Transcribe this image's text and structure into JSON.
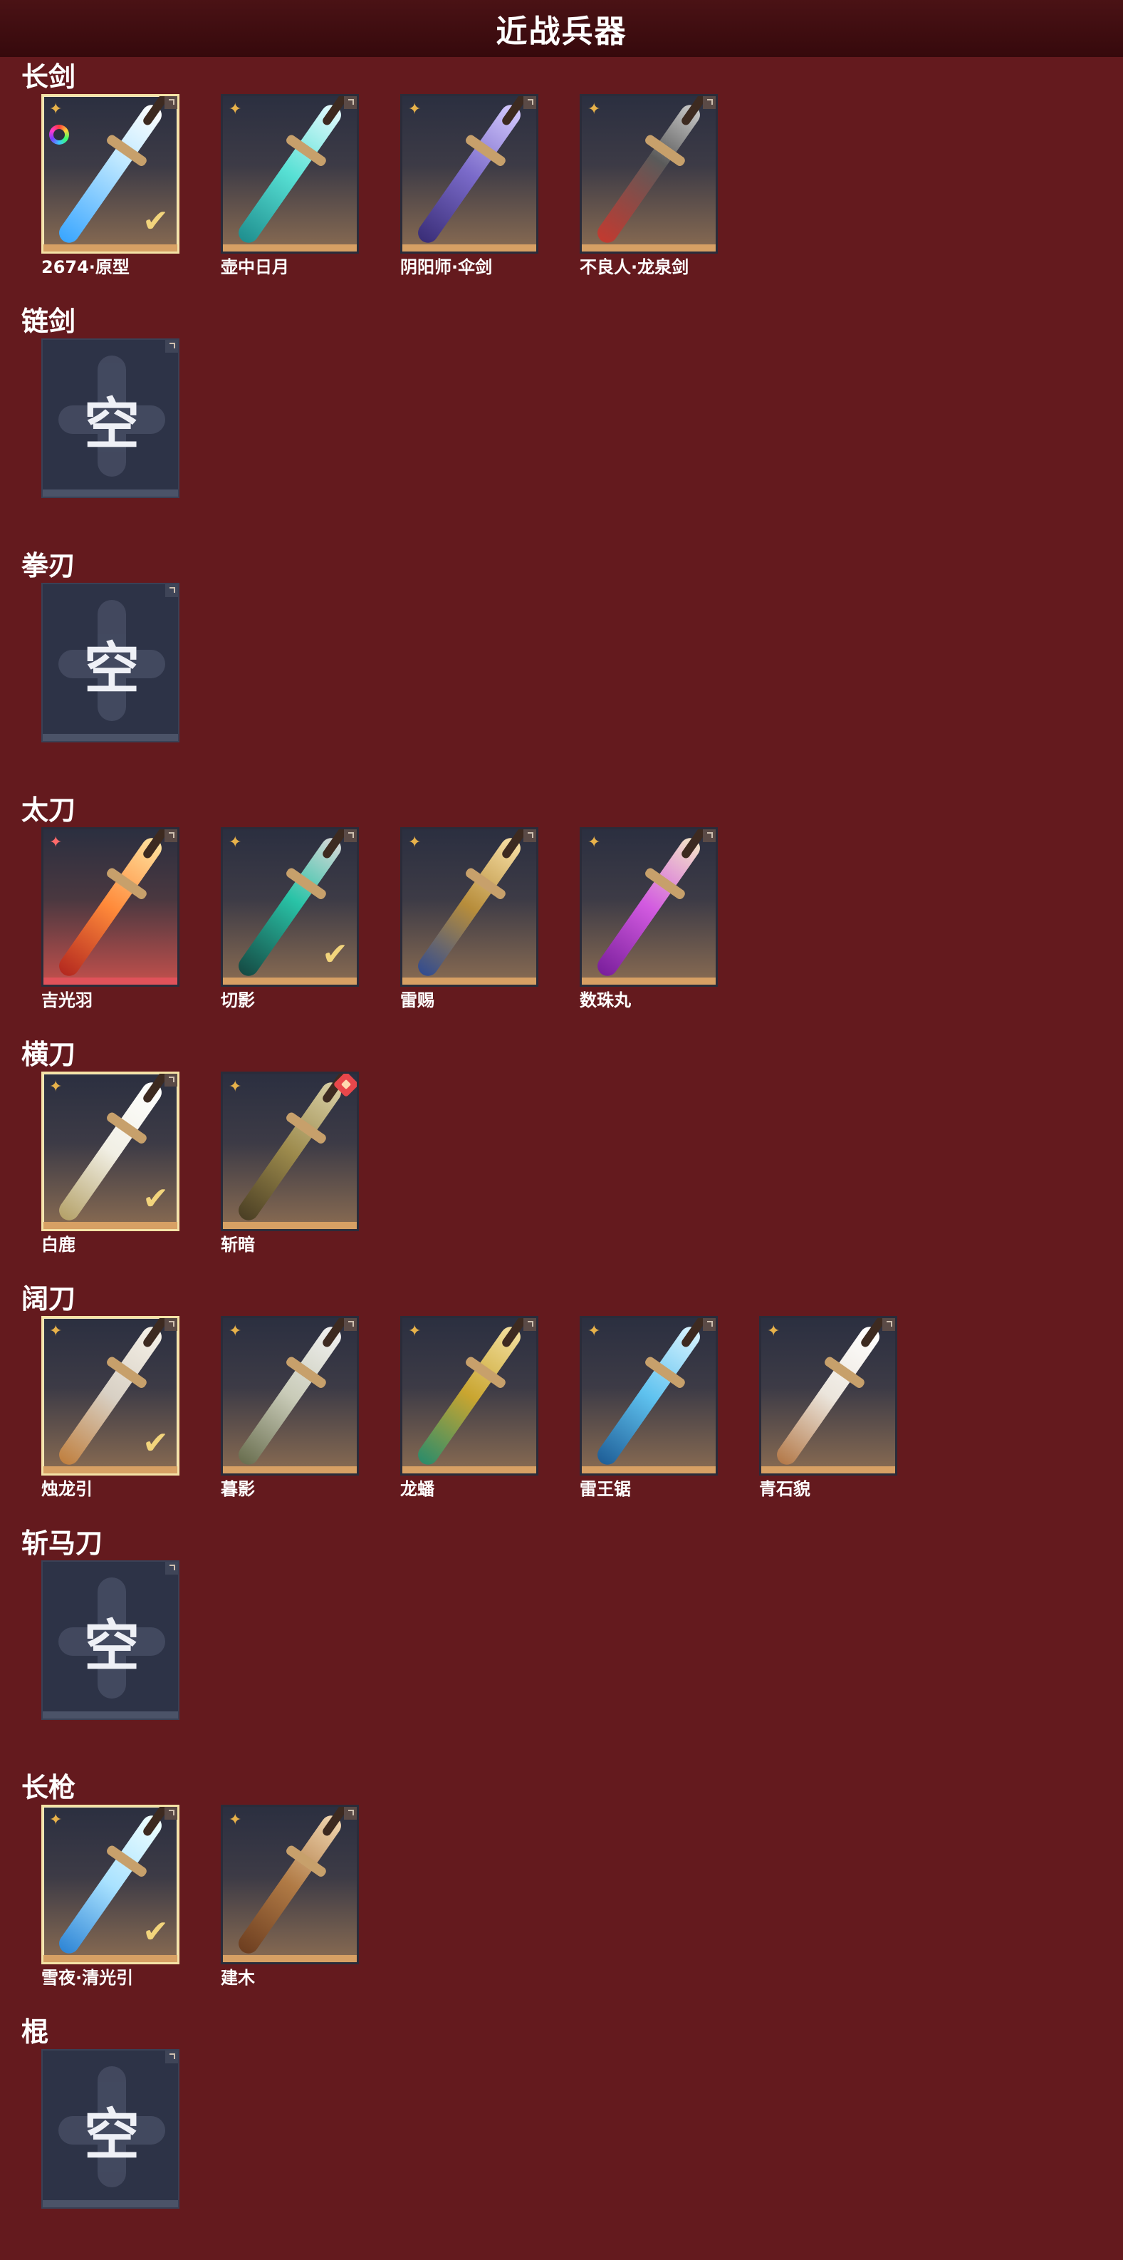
{
  "title": "近战兵器",
  "empty_label": "空",
  "rarity_glyph": "✦",
  "check_glyph": "✔",
  "accent": "#d7a064",
  "sections": [
    {
      "title": "长剑",
      "items": [
        {
          "name": "2674·原型",
          "selected": true,
          "color_variant": true,
          "blade": "linear-gradient(to bottom,#ffffff,#bfe8ff 40%,#3aa6ff)"
        },
        {
          "name": "壶中日月",
          "blade": "linear-gradient(to bottom,#e6fbff,#57e0d4 50%,#1f8f8f)"
        },
        {
          "name": "阴阳师·伞剑",
          "blade": "linear-gradient(to bottom,#d5cbff,#7a6ac9 50%,#3a2e78)"
        },
        {
          "name": "不良人·龙泉剑",
          "blade": "linear-gradient(to bottom,#c9c9c9,#5a5a5a 40%,#c23a30)"
        }
      ]
    },
    {
      "title": "链剑",
      "items": [],
      "empty": true
    },
    {
      "title": "拳刃",
      "items": [],
      "empty": true
    },
    {
      "title": "太刀",
      "items": [
        {
          "name": "吉光羽",
          "red": true,
          "blade": "linear-gradient(to bottom,#ffe3a0,#ff8a3a 50%,#b4291f)"
        },
        {
          "name": "切影",
          "selected_check": true,
          "blade": "linear-gradient(to bottom,#d8d8d8,#29c3a7 45%,#154b44)"
        },
        {
          "name": "雷赐",
          "blade": "linear-gradient(to bottom,#f8e0a6,#b78d3b 50%,#334c8f)"
        },
        {
          "name": "数珠丸",
          "blade": "linear-gradient(to bottom,#f4e6c8,#d25ae0 50%,#7a1f9c)"
        }
      ]
    },
    {
      "title": "横刀",
      "items": [
        {
          "name": "白鹿",
          "selected": true,
          "blade": "linear-gradient(to bottom,#ffffff,#f1efe4 50%,#b5a26a)"
        },
        {
          "name": "斩暗",
          "new_badge": true,
          "blade": "linear-gradient(to bottom,#d9d0a6,#9c8a4c 50%,#4b3f24)"
        }
      ]
    },
    {
      "title": "阔刀",
      "items": [
        {
          "name": "烛龙引",
          "selected": true,
          "blade": "linear-gradient(to bottom,#f5f1e8,#d8d0c4 50%,#c08040)"
        },
        {
          "name": "暮影",
          "blade": "linear-gradient(to bottom,#f1f1f1,#c9cbb8 50%,#6a6f50)"
        },
        {
          "name": "龙蟠",
          "blade": "linear-gradient(to bottom,#f3e0a0,#c9a530 50%,#2c8c6a)"
        },
        {
          "name": "雷王锯",
          "blade": "linear-gradient(to bottom,#d9f4ff,#5fc2ef 50%,#1f5f98)"
        },
        {
          "name": "青石貌",
          "blade": "linear-gradient(to bottom,#ffffff,#ebe5dc 50%,#b47a4a)"
        }
      ]
    },
    {
      "title": "斩马刀",
      "items": [],
      "empty": true
    },
    {
      "title": "长枪",
      "items": [
        {
          "name": "雪夜·清光引",
          "selected": true,
          "blade": "linear-gradient(to bottom,#f0ffff,#a9e2ff 50%,#2f86d6)"
        },
        {
          "name": "建木",
          "blade": "linear-gradient(to bottom,#f1d7b1,#b07a45 50%,#6d3e20)"
        }
      ]
    },
    {
      "title": "棍",
      "items": [],
      "empty": true
    }
  ]
}
